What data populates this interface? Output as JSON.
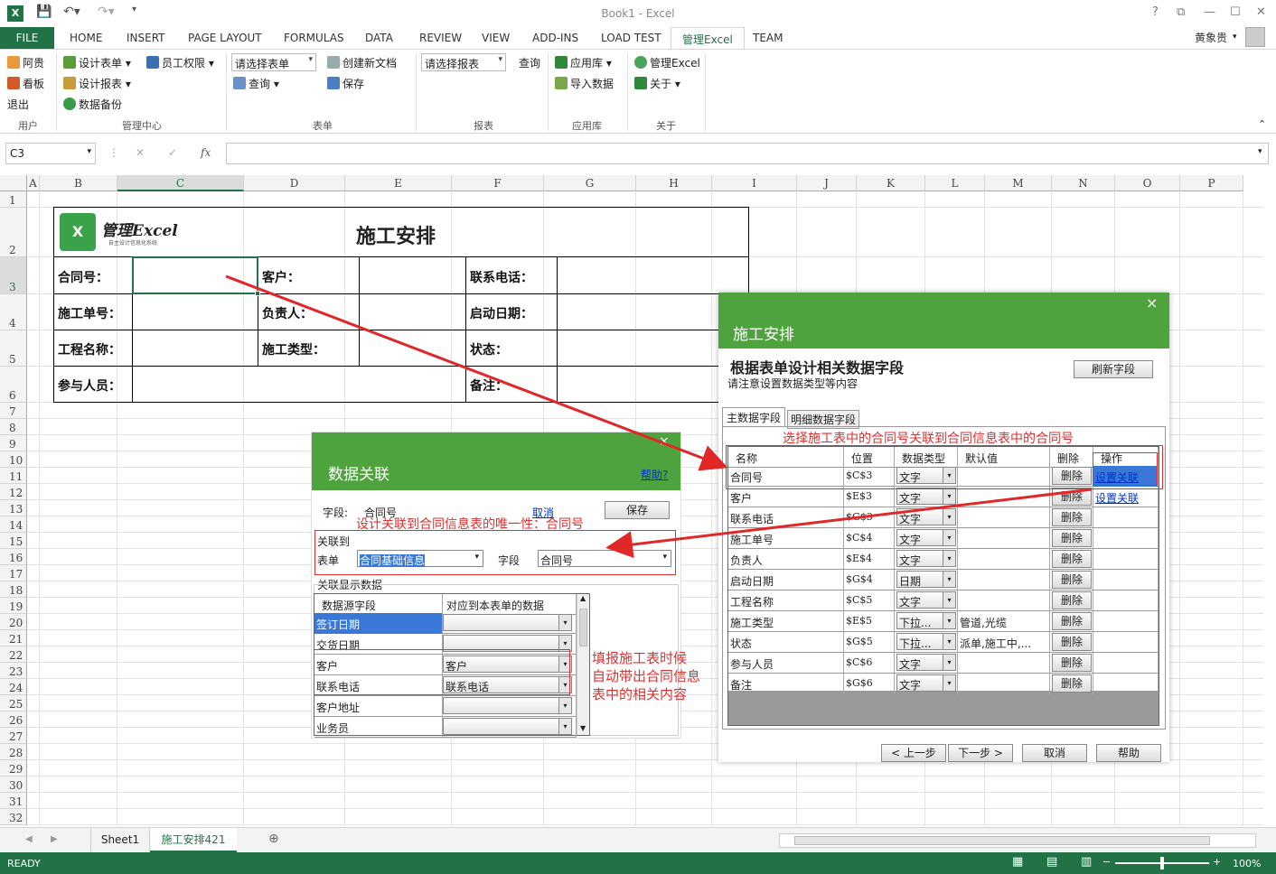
{
  "window": {
    "title": "Book1 - Excel",
    "user": "黄象贵"
  },
  "tabs": [
    "FILE",
    "HOME",
    "INSERT",
    "PAGE LAYOUT",
    "FORMULAS",
    "DATA",
    "REVIEW",
    "VIEW",
    "ADD-INS",
    "LOAD TEST",
    "管理Excel",
    "TEAM"
  ],
  "ribbon": {
    "user_group": {
      "label": "用户",
      "items": [
        "阿贵",
        "看板",
        "退出"
      ]
    },
    "center_group": {
      "label": "管理中心",
      "items": [
        "设计表单",
        "员工权限",
        "设计报表",
        "数据备份"
      ]
    },
    "form_group": {
      "label": "表单",
      "combo": "请选择表单",
      "items": [
        "创建新文档",
        "查询",
        "保存"
      ]
    },
    "report_group": {
      "label": "报表",
      "combo": "请选择报表",
      "items": [
        "查询"
      ]
    },
    "app_group": {
      "label": "应用库",
      "items": [
        "应用库",
        "导入数据"
      ]
    },
    "about_group": {
      "label": "关于",
      "items": [
        "管理Excel",
        "关于"
      ]
    }
  },
  "formula_bar": {
    "namebox": "C3",
    "fx": "fx",
    "value": ""
  },
  "columns": [
    "A",
    "B",
    "C",
    "D",
    "E",
    "F",
    "G",
    "H",
    "I",
    "J",
    "K",
    "L",
    "M",
    "N",
    "O",
    "P"
  ],
  "rows": [
    "1",
    "2",
    "3",
    "4",
    "5",
    "6",
    "7",
    "8",
    "9",
    "10",
    "11",
    "12",
    "13",
    "14",
    "15",
    "16",
    "17",
    "18",
    "19",
    "20",
    "21",
    "22",
    "23",
    "24",
    "25",
    "26",
    "27",
    "28",
    "29",
    "30",
    "31",
    "32"
  ],
  "form": {
    "logo_text": "管理Excel",
    "logo_sub": "自主设计信息化系统",
    "title": "施工安排",
    "labels": [
      "合同号：",
      "客户：",
      "联系电话：",
      "施工单号：",
      "负责人：",
      "启动日期：",
      "工程名称：",
      "施工类型：",
      "状态：",
      "参与人员：",
      "备注："
    ]
  },
  "dialog_main": {
    "title": "施工安排",
    "heading": "根据表单设计相关数据字段",
    "subheading": "请注意设置数据类型等内容",
    "refresh_button": "刷新字段",
    "tabs": [
      "主数据字段",
      "明细数据字段"
    ],
    "columns": [
      "名称",
      "位置",
      "数据类型",
      "默认值",
      "删除",
      "操作"
    ],
    "rows": [
      {
        "name": "合同号",
        "pos": "$C$3",
        "type": "文字",
        "default": "",
        "del": "删除",
        "op": "设置关联"
      },
      {
        "name": "客户",
        "pos": "$E$3",
        "type": "文字",
        "default": "",
        "del": "删除",
        "op": "设置关联"
      },
      {
        "name": "联系电话",
        "pos": "$G$3",
        "type": "文字",
        "default": "",
        "del": "删除",
        "op": ""
      },
      {
        "name": "施工单号",
        "pos": "$C$4",
        "type": "文字",
        "default": "",
        "del": "删除",
        "op": ""
      },
      {
        "name": "负责人",
        "pos": "$E$4",
        "type": "文字",
        "default": "",
        "del": "删除",
        "op": ""
      },
      {
        "name": "启动日期",
        "pos": "$G$4",
        "type": "日期",
        "default": "",
        "del": "删除",
        "op": ""
      },
      {
        "name": "工程名称",
        "pos": "$C$5",
        "type": "文字",
        "default": "",
        "del": "删除",
        "op": ""
      },
      {
        "name": "施工类型",
        "pos": "$E$5",
        "type": "下拉...",
        "default": "管道,光缆",
        "del": "删除",
        "op": ""
      },
      {
        "name": "状态",
        "pos": "$G$5",
        "type": "下拉...",
        "default": "派单,施工中,...",
        "del": "删除",
        "op": ""
      },
      {
        "name": "参与人员",
        "pos": "$C$6",
        "type": "文字",
        "default": "",
        "del": "删除",
        "op": ""
      },
      {
        "name": "备注",
        "pos": "$G$6",
        "type": "文字",
        "default": "",
        "del": "删除",
        "op": ""
      }
    ],
    "annotation": "选择施工表中的合同号关联到合同信息表中的合同号",
    "buttons": [
      "< 上一步",
      "下一步 >",
      "取消",
      "帮助"
    ],
    "close": "×"
  },
  "dialog_link": {
    "title": "数据关联",
    "help": "帮助?",
    "field_label": "字段:",
    "field_value": "合同号",
    "cancel": "取消",
    "save": "保存",
    "annotation": "设计关联到合同信息表的唯一性：合同号",
    "group_label": "关联到",
    "table_label": "表单",
    "table_value": "合同基础信息",
    "field2_label": "字段",
    "field2_value": "合同号",
    "display_label": "关联显示数据",
    "grid_headers": [
      "数据源字段",
      "对应到本表单的数据"
    ],
    "grid_rows": [
      {
        "src": "签订日期",
        "dst": ""
      },
      {
        "src": "交货日期",
        "dst": ""
      },
      {
        "src": "客户",
        "dst": "客户"
      },
      {
        "src": "联系电话",
        "dst": "联系电话"
      },
      {
        "src": "客户地址",
        "dst": ""
      },
      {
        "src": "业务员",
        "dst": ""
      }
    ],
    "annotation2": [
      "填报施工表时候",
      "自动带出合同信息",
      "表中的相关内容"
    ],
    "close": "×"
  },
  "sheet_tabs": [
    "Sheet1",
    "施工安排421"
  ],
  "status": {
    "left": "READY",
    "zoom": "100%"
  }
}
